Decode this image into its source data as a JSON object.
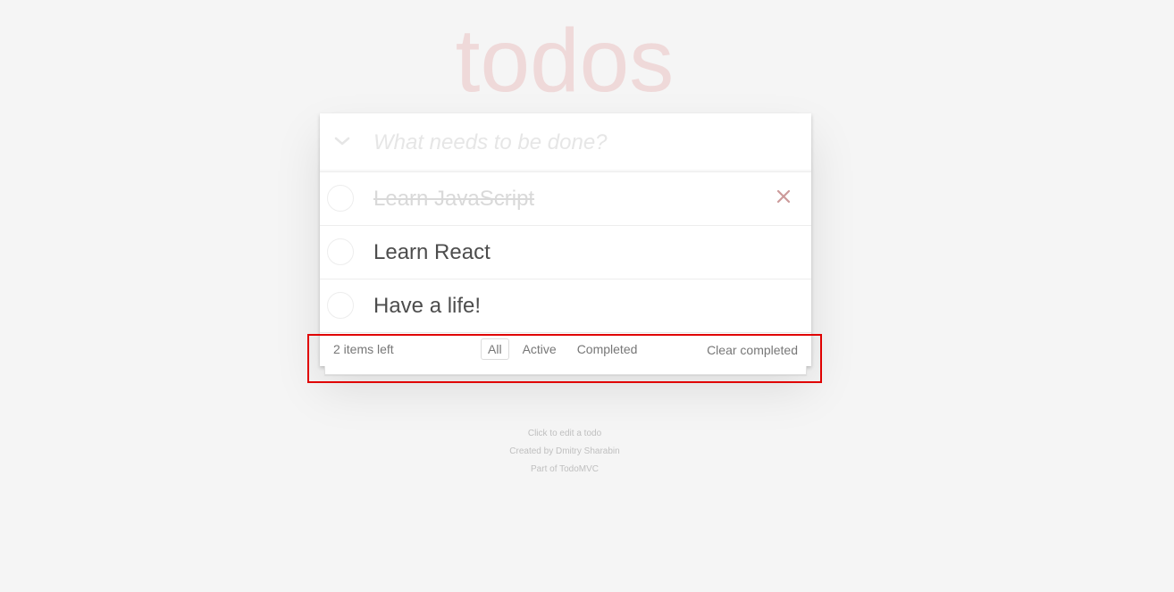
{
  "app": {
    "title": "todos"
  },
  "header": {
    "toggle_icon": "chevron-down-icon",
    "new_todo_placeholder": "What needs to be done?"
  },
  "todos": [
    {
      "label": "Learn JavaScript",
      "completed": true
    },
    {
      "label": "Learn React",
      "completed": false
    },
    {
      "label": "Have a life!",
      "completed": false
    }
  ],
  "footer": {
    "count_text": "2 items left",
    "filters": [
      {
        "label": "All",
        "selected": true
      },
      {
        "label": "Active",
        "selected": false
      },
      {
        "label": "Completed",
        "selected": false
      }
    ],
    "clear_completed_label": "Clear completed"
  },
  "info": {
    "line1": "Click to edit a todo",
    "line2": "Created by Dmitry Sharabin",
    "line3": "Part of TodoMVC"
  },
  "colors": {
    "title": "#efd9d9",
    "destroy": "#cc9a9a",
    "highlight": "#e00000"
  }
}
